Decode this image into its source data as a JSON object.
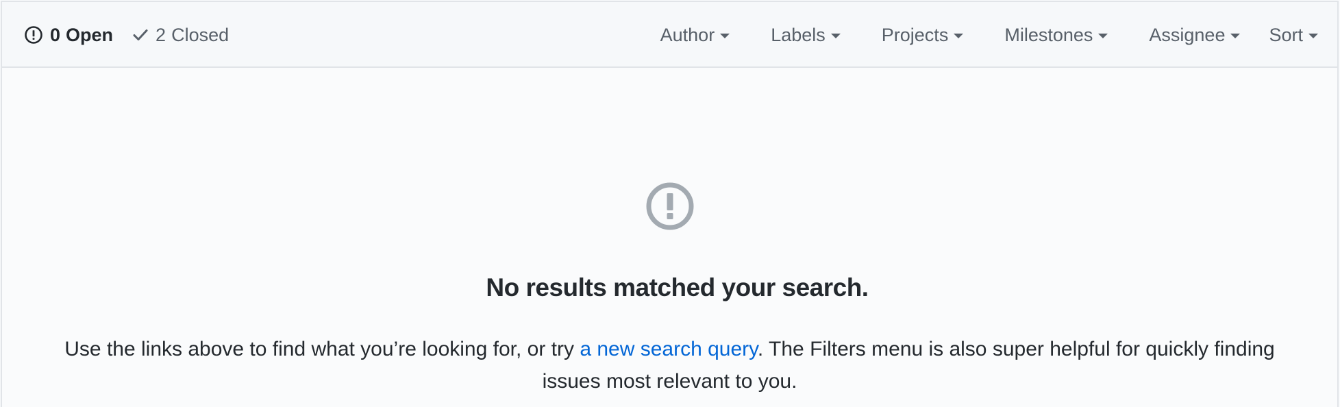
{
  "states": {
    "open": {
      "count": "0",
      "label": "Open"
    },
    "closed": {
      "count": "2",
      "label": "Closed"
    }
  },
  "filters": {
    "author": "Author",
    "labels": "Labels",
    "projects": "Projects",
    "milestones": "Milestones",
    "assignee": "Assignee",
    "sort": "Sort"
  },
  "blankslate": {
    "icon": "issue-opened-icon",
    "title": "No results matched your search.",
    "desc_before": "Use the links above to find what you’re looking for, or try ",
    "link": "a new search query",
    "desc_after": ". The Filters menu is also super helpful for quickly finding issues most relevant to you."
  },
  "colors": {
    "text": "#24292e",
    "muted": "#586069",
    "link": "#0366d6",
    "icon_gray": "#a3aab1",
    "header_bg": "#f6f8fa",
    "border": "#e1e4e8"
  }
}
